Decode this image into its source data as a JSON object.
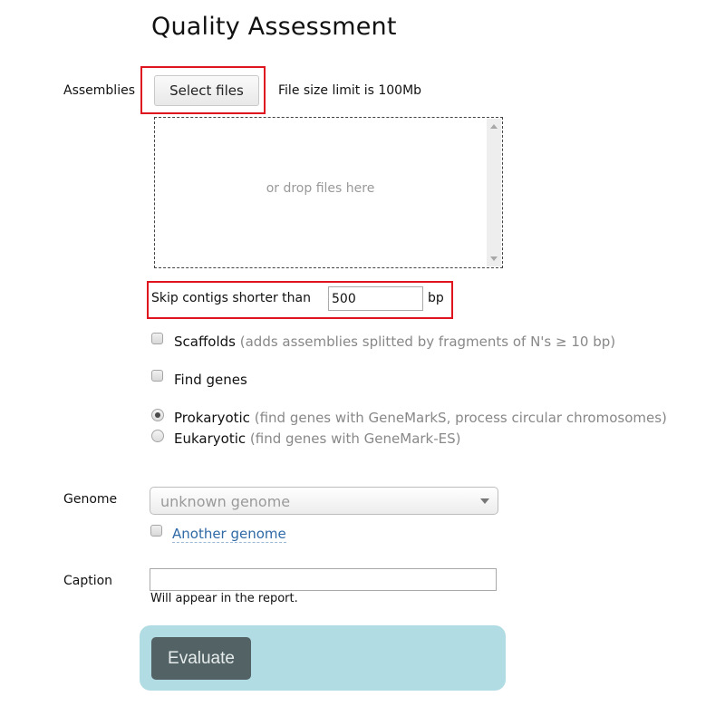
{
  "page": {
    "title": "Quality Assessment"
  },
  "assemblies": {
    "label": "Assemblies",
    "select_button": "Select files",
    "size_limit": "File size limit is 100Mb",
    "drop_text": "or drop files here"
  },
  "skip_contigs": {
    "label": "Skip contigs shorter than",
    "value": "500",
    "unit": "bp"
  },
  "options": {
    "scaffolds": {
      "label": "Scaffolds",
      "hint": "(adds assemblies splitted by fragments of N's ≥ 10 bp)",
      "checked": false
    },
    "find_genes": {
      "label": "Find genes",
      "checked": false
    },
    "kingdom": [
      {
        "label": "Prokaryotic",
        "hint": "(find genes with GeneMarkS, process circular chromosomes)",
        "selected": true
      },
      {
        "label": "Eukaryotic",
        "hint": "(find genes with GeneMark-ES)",
        "selected": false
      }
    ]
  },
  "genome": {
    "label": "Genome",
    "selected": "unknown genome",
    "another_label": "Another genome",
    "another_checked": false
  },
  "caption": {
    "label": "Caption",
    "value": "",
    "hint": "Will appear in the report."
  },
  "submit": {
    "label": "Evaluate"
  },
  "colors": {
    "highlight": "#e0141e",
    "panel": "#b2dce3",
    "button": "#536265",
    "link": "#2f6aa6"
  }
}
